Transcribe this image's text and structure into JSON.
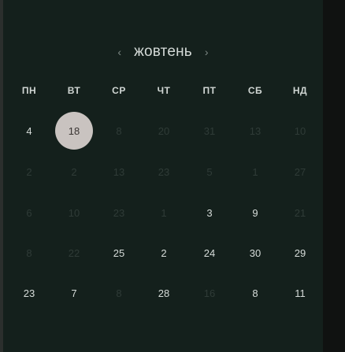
{
  "calendar": {
    "month": "жовтень",
    "prev_icon": "chevron-left-icon",
    "next_icon": "chevron-right-icon",
    "weekdays": [
      "ПН",
      "ВТ",
      "СР",
      "ЧТ",
      "ПТ",
      "СБ",
      "НД"
    ],
    "weeks": [
      [
        {
          "label": "4",
          "state": "active"
        },
        {
          "label": "18",
          "state": "selected"
        },
        {
          "label": "8",
          "state": "muted"
        },
        {
          "label": "20",
          "state": "muted"
        },
        {
          "label": "31",
          "state": "muted"
        },
        {
          "label": "13",
          "state": "muted"
        },
        {
          "label": "10",
          "state": "muted"
        }
      ],
      [
        {
          "label": "2",
          "state": "muted"
        },
        {
          "label": "2",
          "state": "muted"
        },
        {
          "label": "13",
          "state": "muted"
        },
        {
          "label": "23",
          "state": "muted"
        },
        {
          "label": "5",
          "state": "muted"
        },
        {
          "label": "1",
          "state": "muted"
        },
        {
          "label": "27",
          "state": "muted"
        }
      ],
      [
        {
          "label": "6",
          "state": "muted"
        },
        {
          "label": "10",
          "state": "muted"
        },
        {
          "label": "23",
          "state": "muted"
        },
        {
          "label": "1",
          "state": "muted"
        },
        {
          "label": "3",
          "state": "active"
        },
        {
          "label": "9",
          "state": "active"
        },
        {
          "label": "21",
          "state": "muted"
        }
      ],
      [
        {
          "label": "8",
          "state": "muted"
        },
        {
          "label": "22",
          "state": "muted"
        },
        {
          "label": "25",
          "state": "active"
        },
        {
          "label": "2",
          "state": "active"
        },
        {
          "label": "24",
          "state": "active"
        },
        {
          "label": "30",
          "state": "active"
        },
        {
          "label": "29",
          "state": "active"
        }
      ],
      [
        {
          "label": "23",
          "state": "active"
        },
        {
          "label": "7",
          "state": "active"
        },
        {
          "label": "8",
          "state": "muted"
        },
        {
          "label": "28",
          "state": "active"
        },
        {
          "label": "16",
          "state": "muted"
        },
        {
          "label": "8",
          "state": "active"
        },
        {
          "label": "11",
          "state": "active"
        }
      ]
    ]
  }
}
